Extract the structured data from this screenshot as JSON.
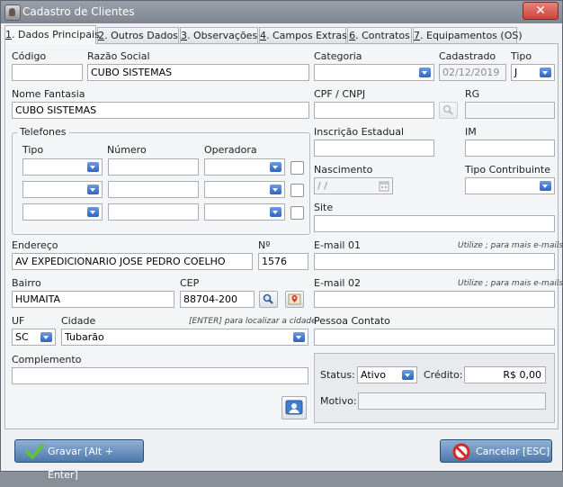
{
  "window": {
    "title": "Cadastro de Clientes",
    "close_symbol": "✕"
  },
  "tabs": [
    {
      "key": "1",
      "label": ". Dados Principais"
    },
    {
      "key": "2",
      "label": ". Outros Dados"
    },
    {
      "key": "3",
      "label": ". Observações"
    },
    {
      "key": "4",
      "label": ". Campos Extras"
    },
    {
      "key": "6",
      "label": ". Contratos"
    },
    {
      "key": "7",
      "label": ". Equipamentos (OS)"
    }
  ],
  "form": {
    "codigo": {
      "label": "Código",
      "value": ""
    },
    "razao_social": {
      "label": "Razão Social",
      "value": "CUBO SISTEMAS"
    },
    "categoria": {
      "label": "Categoria",
      "value": ""
    },
    "cadastrado": {
      "label": "Cadastrado",
      "value": "02/12/2019"
    },
    "tipo": {
      "label": "Tipo",
      "value": "J"
    },
    "nome_fantasia": {
      "label": "Nome Fantasia",
      "value": "CUBO SISTEMAS"
    },
    "cpf_cnpj": {
      "label": "CPF / CNPJ",
      "value": ""
    },
    "rg": {
      "label": "RG",
      "value": ""
    },
    "inscricao_estadual": {
      "label": "Inscrição Estadual",
      "value": ""
    },
    "im": {
      "label": "IM",
      "value": ""
    },
    "nascimento": {
      "label": "Nascimento",
      "value": " / /"
    },
    "tipo_contribuinte": {
      "label": "Tipo Contribuinte",
      "value": ""
    },
    "site": {
      "label": "Site",
      "value": ""
    },
    "endereco": {
      "label": "Endereço",
      "value": "AV EXPEDICIONARIO JOSE PEDRO COELHO"
    },
    "numero": {
      "label": "Nº",
      "value": "1576"
    },
    "email1": {
      "label": "E-mail 01",
      "hint": "Utilize ; para mais e-mails.",
      "value": ""
    },
    "bairro": {
      "label": "Bairro",
      "value": "HUMAITA"
    },
    "cep": {
      "label": "CEP",
      "value": "88704-200"
    },
    "email2": {
      "label": "E-mail 02",
      "hint": "Utilize ; para mais e-mails.",
      "value": ""
    },
    "uf": {
      "label": "UF",
      "value": "SC"
    },
    "cidade": {
      "label": "Cidade",
      "hint": "[ENTER] para localizar a cidade",
      "value": "Tubarão"
    },
    "pessoa_contato": {
      "label": "Pessoa Contato",
      "value": ""
    },
    "complemento": {
      "label": "Complemento",
      "value": ""
    }
  },
  "telefones": {
    "title": "Telefones",
    "col_tipo": "Tipo",
    "col_numero": "Número",
    "col_operadora": "Operadora",
    "rows": [
      {
        "tipo": "",
        "numero": "",
        "operadora": ""
      },
      {
        "tipo": "",
        "numero": "",
        "operadora": ""
      },
      {
        "tipo": "",
        "numero": "",
        "operadora": ""
      }
    ]
  },
  "status": {
    "status_label": "Status:",
    "status_value": "Ativo",
    "credito_label": "Crédito:",
    "credito_value": "R$ 0,00",
    "motivo_label": "Motivo:",
    "motivo_value": ""
  },
  "buttons": {
    "save": "Gravar [Alt + Enter]",
    "cancel": "Cancelar [ESC]"
  },
  "colors": {
    "accent": "#4f79ab",
    "dropdown": "#2f63bf",
    "close": "#c9463e"
  }
}
